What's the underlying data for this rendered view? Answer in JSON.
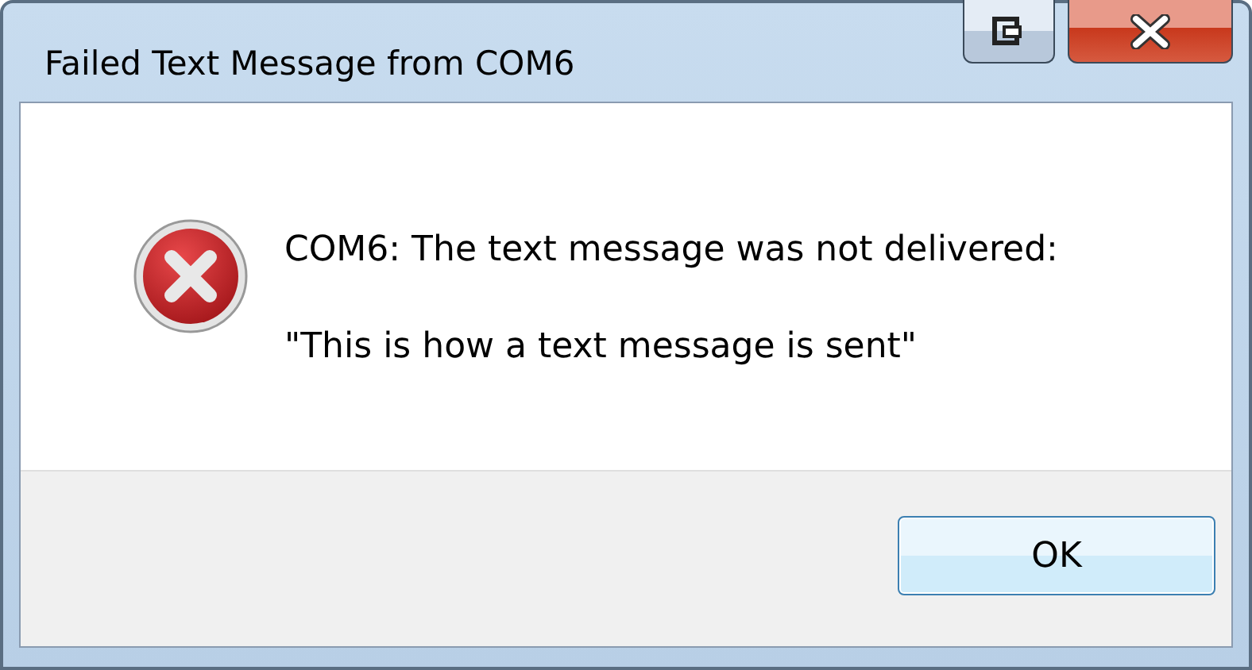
{
  "window": {
    "title": "Failed Text Message from COM6"
  },
  "message": {
    "heading": "COM6: The text message was not delivered:",
    "body": "\"This is how a text message is sent\""
  },
  "buttons": [
    {
      "label": "OK"
    }
  ]
}
